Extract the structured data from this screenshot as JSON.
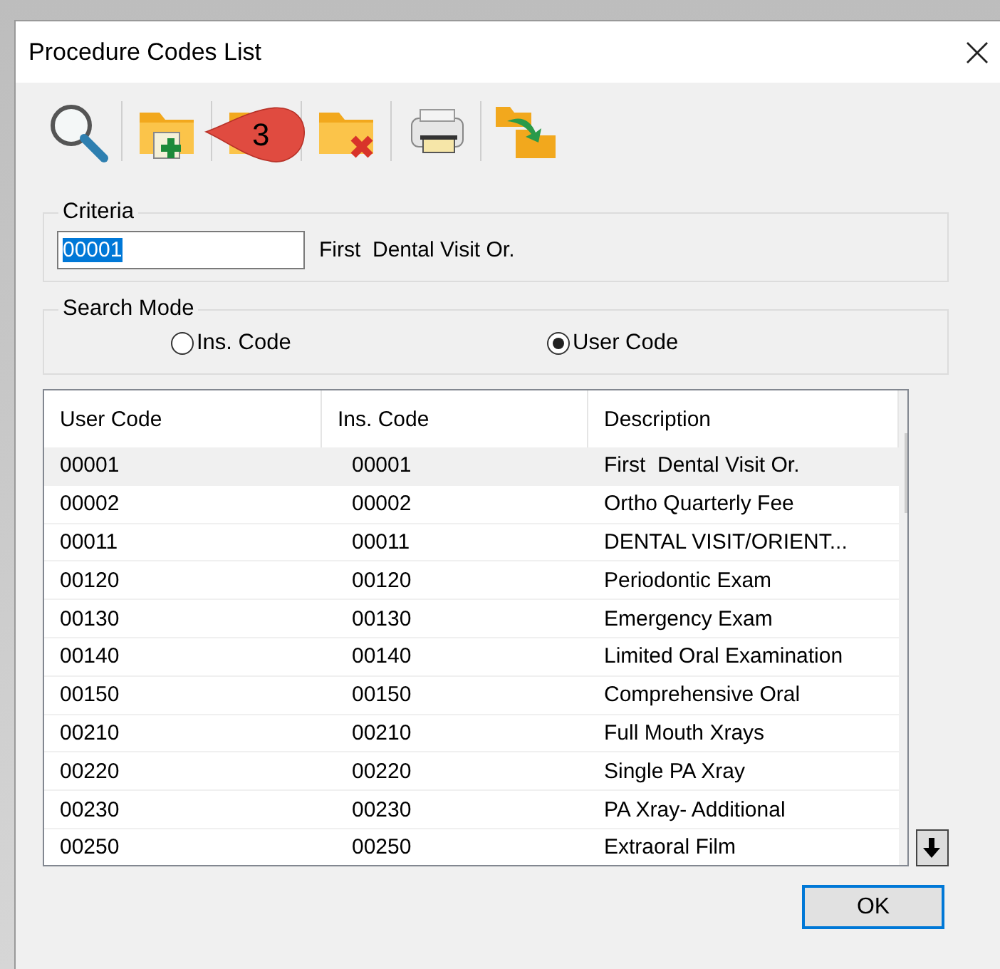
{
  "window": {
    "title": "Procedure Codes List"
  },
  "callout": {
    "label": "3"
  },
  "criteria": {
    "legend": "Criteria",
    "value": "00001",
    "text_selected": true,
    "description": "First  Dental Visit Or."
  },
  "search_mode": {
    "legend": "Search Mode",
    "options": [
      {
        "label": "Ins. Code",
        "selected": false
      },
      {
        "label": "User Code",
        "selected": true
      }
    ]
  },
  "table": {
    "columns": [
      "User Code",
      "Ins. Code",
      "Description"
    ],
    "rows": [
      {
        "cells": [
          "00001",
          "00001",
          "First  Dental Visit Or."
        ],
        "selected": true
      },
      {
        "cells": [
          "00002",
          "00002",
          "Ortho Quarterly Fee"
        ],
        "selected": false
      },
      {
        "cells": [
          "00011",
          "00011",
          "DENTAL VISIT/ORIENT..."
        ],
        "selected": false
      },
      {
        "cells": [
          "00120",
          "00120",
          "Periodontic Exam"
        ],
        "selected": false
      },
      {
        "cells": [
          "00130",
          "00130",
          "Emergency Exam"
        ],
        "selected": false
      },
      {
        "cells": [
          "00140",
          "00140",
          "Limited Oral Examination"
        ],
        "selected": false
      },
      {
        "cells": [
          "00150",
          "00150",
          "Comprehensive Oral"
        ],
        "selected": false
      },
      {
        "cells": [
          "00210",
          "00210",
          "Full Mouth Xrays"
        ],
        "selected": false
      },
      {
        "cells": [
          "00220",
          "00220",
          "Single PA Xray"
        ],
        "selected": false
      },
      {
        "cells": [
          "00230",
          "00230",
          "PA Xray- Additional"
        ],
        "selected": false
      },
      {
        "cells": [
          "00250",
          "00250",
          "Extraoral Film"
        ],
        "selected": false
      }
    ]
  },
  "ok_button": "OK"
}
